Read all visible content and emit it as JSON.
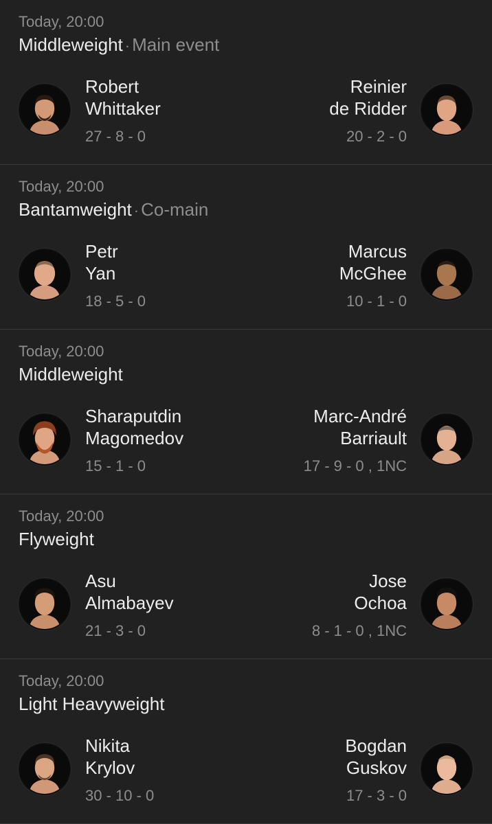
{
  "fights": [
    {
      "time": "Today, 20:00",
      "weight_class": "Middleweight",
      "separator": "·",
      "bout_tag": "Main event",
      "red": {
        "first_name": "Robert",
        "last_name": "Whittaker",
        "record": "27 - 8 - 0"
      },
      "blue": {
        "first_name": "Reinier",
        "last_name": "de Ridder",
        "record": "20 - 2 - 0"
      }
    },
    {
      "time": "Today, 20:00",
      "weight_class": "Bantamweight",
      "separator": "·",
      "bout_tag": "Co-main",
      "red": {
        "first_name": "Petr",
        "last_name": "Yan",
        "record": "18 - 5 - 0"
      },
      "blue": {
        "first_name": "Marcus",
        "last_name": "McGhee",
        "record": "10 - 1 - 0"
      }
    },
    {
      "time": "Today, 20:00",
      "weight_class": "Middleweight",
      "red": {
        "first_name": "Sharaputdin",
        "last_name": "Magomedov",
        "record": "15 - 1 - 0"
      },
      "blue": {
        "first_name": "Marc-André",
        "last_name": "Barriault",
        "record": "17 - 9 - 0 , 1NC"
      }
    },
    {
      "time": "Today, 20:00",
      "weight_class": "Flyweight",
      "red": {
        "first_name": "Asu",
        "last_name": "Almabayev",
        "record": "21 - 3 - 0"
      },
      "blue": {
        "first_name": "Jose",
        "last_name": "Ochoa",
        "record": "8 - 1 - 0 , 1NC"
      }
    },
    {
      "time": "Today, 20:00",
      "weight_class": "Light Heavyweight",
      "red": {
        "first_name": "Nikita",
        "last_name": "Krylov",
        "record": "30 - 10 - 0"
      },
      "blue": {
        "first_name": "Bogdan",
        "last_name": "Guskov",
        "record": "17 - 3 - 0"
      }
    }
  ],
  "colors": {
    "background": "#212121",
    "divider": "#3a3a3a",
    "text_primary": "#ececec",
    "text_secondary": "#8d8d8d"
  }
}
